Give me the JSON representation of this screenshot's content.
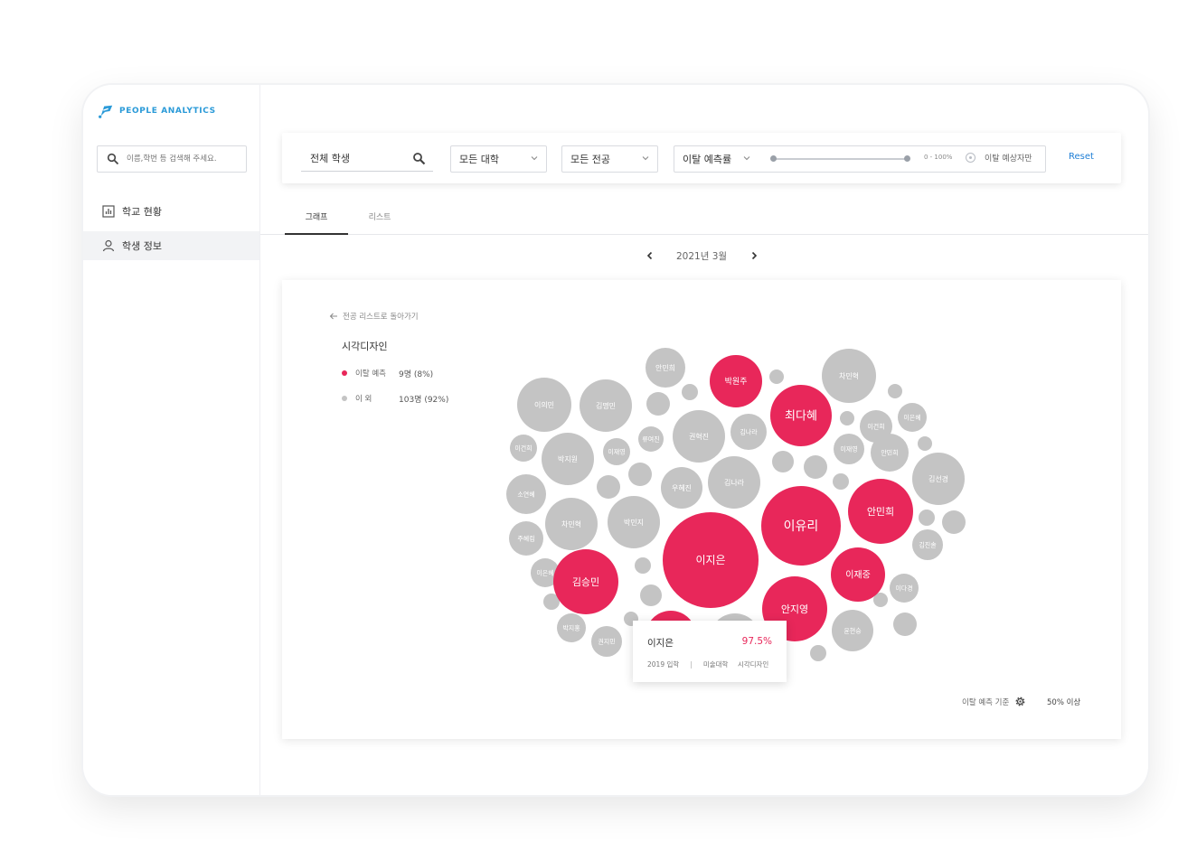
{
  "app": {
    "logo_text": "PEOPLE ANALYTICS"
  },
  "search": {
    "placeholder": "이름,학번 등 검색해 주세요."
  },
  "sidebar": {
    "items": [
      {
        "label": "학교 현황",
        "icon": "bar-chart-icon"
      },
      {
        "label": "학생 정보",
        "icon": "user-icon"
      }
    ]
  },
  "filters": {
    "scope": "전체 학생",
    "college": "모든 대학",
    "major": "모든 전공",
    "metric": "이탈 예측률",
    "range_text": "0 - 100%",
    "radio_label": "이탈 예상자만",
    "reset": "Reset"
  },
  "tabs": [
    {
      "label": "그래프"
    },
    {
      "label": "리스트"
    }
  ],
  "month": {
    "label": "2021년 3월"
  },
  "card": {
    "back_label": "전공 리스트로 돌아가기",
    "major": "시각디자인",
    "legend": [
      {
        "label": "이탈 예측",
        "value": "9명 (8%)",
        "color": "#e8275a"
      },
      {
        "label": "이 외",
        "value": "103명 (92%)",
        "color": "#c4c4c4"
      }
    ],
    "criteria_label": "이탈 예측 기준",
    "criteria_value": "50% 이상"
  },
  "tooltip": {
    "name": "이지은",
    "pct": "97.5%",
    "year": "2019 입학",
    "college": "미술대학",
    "major": "시각디자인"
  },
  "colors": {
    "accent": "#e8275a",
    "gray": "#c4c4c4",
    "link": "#1f7fd6"
  },
  "chart_data": {
    "type": "bubble",
    "risk_labels": [
      "박원주",
      "최다혜",
      "이유리",
      "안민희",
      "이지은",
      "김승민",
      "이재중",
      "안지영"
    ],
    "other_labels": [
      "안민희",
      "차민혁",
      "이의민",
      "김명민",
      "이건희",
      "이은혜",
      "권혁진",
      "김나라",
      "류여진",
      "이재영",
      "이건희",
      "박지원",
      "이재영",
      "안민희",
      "우혜진",
      "김나라",
      "김선경",
      "소연혜",
      "차민혁",
      "박민지",
      "주혜림",
      "김진솔",
      "이은혜",
      "이다경",
      "박지홍",
      "권지민",
      "윤현승"
    ]
  }
}
